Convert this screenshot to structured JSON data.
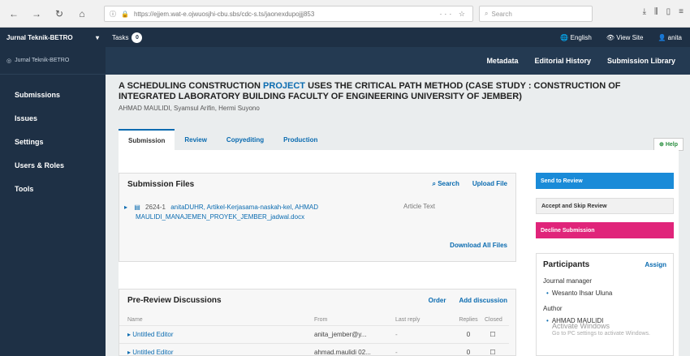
{
  "browser": {
    "url": "https://ejjem.wat-e.ojwuosjhi-cbu.sbs/cdc-s.ts/jaonexdupojjj853",
    "search_placeholder": "Search",
    "url_actions": "··· ☆"
  },
  "header": {
    "journal": "Jurnal Teknik-BETRO",
    "tasks_label": "Tasks",
    "tasks_count": "0",
    "language": "English",
    "view_site": "View Site",
    "user": "anita"
  },
  "sidebar": {
    "brand": "Jurnal Teknik-BETRO",
    "items": [
      {
        "label": "Submissions"
      },
      {
        "label": "Issues"
      },
      {
        "label": "Settings"
      },
      {
        "label": "Users & Roles"
      },
      {
        "label": "Tools"
      }
    ]
  },
  "secnav": {
    "items": [
      {
        "label": "Metadata"
      },
      {
        "label": "Editorial History"
      },
      {
        "label": "Submission Library"
      }
    ]
  },
  "submission": {
    "title_part1": "A SCHEDULING CONSTRUCTION ",
    "title_link": "PROJECT",
    "title_part2": " USES THE CRITICAL PATH METHOD (CASE STUDY : CONSTRUCTION OF INTEGRATED LABORATORY BUILDING FACULTY OF ENGINEERING UNIVERSITY OF JEMBER)",
    "authors": "AHMAD MAULIDI, Syamsul Arifin, Hermi Suyono"
  },
  "tabs": [
    {
      "label": "Submission",
      "active": true
    },
    {
      "label": "Review",
      "active": false
    },
    {
      "label": "Copyediting",
      "active": false
    },
    {
      "label": "Production",
      "active": false
    }
  ],
  "help_label": "Help",
  "submission_files": {
    "title": "Submission Files",
    "search_label": "Search",
    "upload_label": "Upload File",
    "files": [
      {
        "id": "2624-1",
        "name_line1": "anitaDUHR, Artikel-Kerjasama-naskah-kel, AHMAD",
        "name_line2": "MAULIDI_MANAJEMEN_PROYEK_JEMBER_jadwal.docx",
        "type": "Article Text"
      }
    ],
    "download_all": "Download All Files"
  },
  "actions": {
    "send_review": "Send to Review",
    "accept_skip": "Accept and Skip Review",
    "decline": "Decline Submission"
  },
  "discussions": {
    "title": "Pre-Review Discussions",
    "order_label": "Order",
    "add_label": "Add discussion",
    "columns": {
      "name": "Name",
      "from": "From",
      "last_reply": "Last reply",
      "replies": "Replies",
      "closed": "Closed"
    },
    "rows": [
      {
        "name": "Untitled Editor",
        "from": "anita_jember@y...",
        "last_reply": "-",
        "replies": "0",
        "closed": "☐"
      },
      {
        "name": "Untitled Editor",
        "from": "ahmad.maulidi 02...",
        "last_reply": "-",
        "replies": "0",
        "closed": "☐"
      }
    ]
  },
  "participants": {
    "title": "Participants",
    "assign_label": "Assign",
    "groups": [
      {
        "role": "Journal manager",
        "people": [
          "Wesanto Ihsar Uluna"
        ]
      },
      {
        "role": "Author",
        "people": [
          "AHMAD MAULIDI"
        ]
      }
    ]
  },
  "activate": {
    "line1": "Activate Windows",
    "line2": "Go to PC settings to activate Windows."
  }
}
